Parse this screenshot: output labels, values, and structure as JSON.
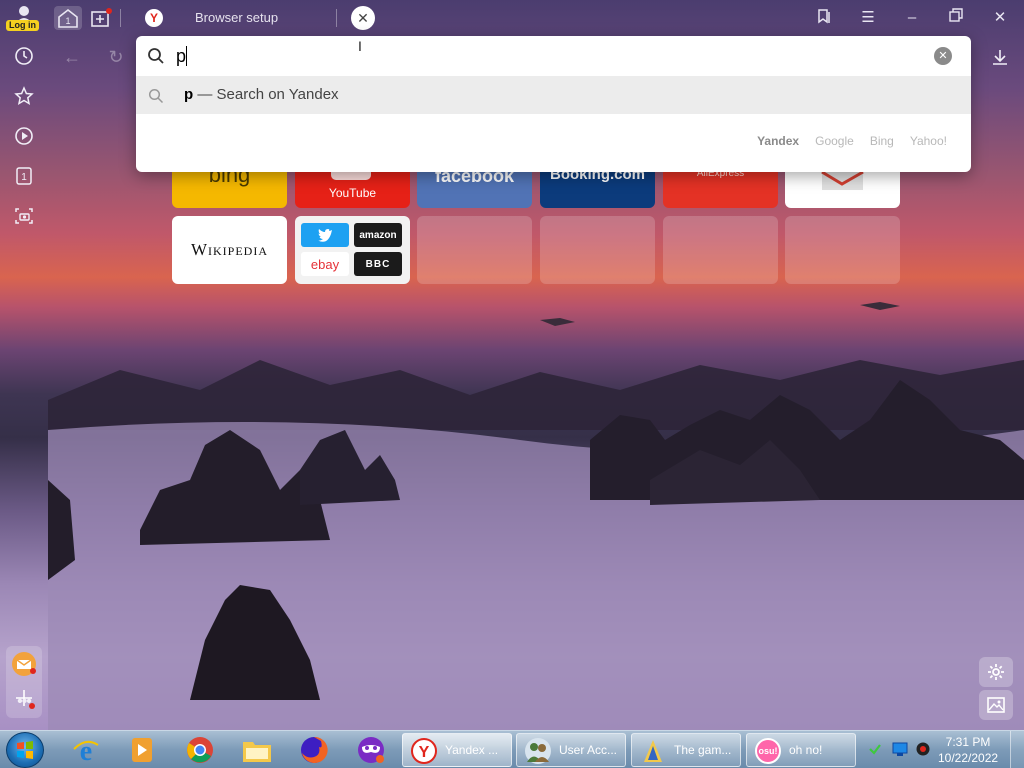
{
  "titlebar": {
    "login_label": "Log in",
    "tab_count": "1",
    "tab_title": "Browser setup",
    "favicon_letter": "Y"
  },
  "search": {
    "value": "p",
    "suggestion_query": "p",
    "suggestion_rest": " — Search on Yandex",
    "engines": [
      {
        "label": "Yandex",
        "active": true
      },
      {
        "label": "Google",
        "active": false
      },
      {
        "label": "Bing",
        "active": false
      },
      {
        "label": "Yahoo!",
        "active": false
      }
    ]
  },
  "sidebar": {
    "tabs_count": "1"
  },
  "speed_dial": {
    "row1": [
      {
        "label": "bing",
        "color": "#f5b800"
      },
      {
        "label": "YouTube",
        "color": "#e62117"
      },
      {
        "label": "facebook",
        "color": "#3b5998"
      },
      {
        "label": "Booking.com",
        "color": "#0c3b7c"
      },
      {
        "label": "AliExpress",
        "color": "#e43225"
      },
      {
        "label": "",
        "color": "#ffffff"
      }
    ],
    "wikipedia_label": "Wikipedia",
    "mini": {
      "amazon": "amazon",
      "ebay": "ebay",
      "bbc": "BBC"
    }
  },
  "taskbar": {
    "tasks": [
      {
        "label": "Yandex ...",
        "active": true
      },
      {
        "label": "User Acc...",
        "active": false
      },
      {
        "label": "The gam...",
        "active": false
      },
      {
        "label": "oh no!",
        "active": false
      }
    ],
    "osu_label": "osu!",
    "time": "7:31 PM",
    "date": "10/22/2022"
  },
  "colors": {
    "yandex_red": "#e0261d",
    "popup_bg": "#ffffff",
    "suggestion_bg": "#ececec"
  }
}
